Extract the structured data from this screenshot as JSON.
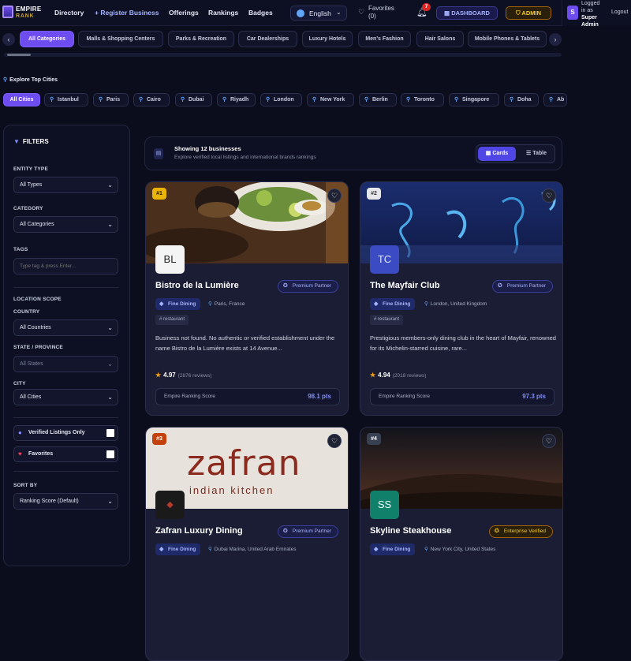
{
  "nav": {
    "logo_line1": "EMPIRE",
    "logo_line2": "RANK",
    "directory": "Directory",
    "register": "+ Register Business",
    "offerings": "Offerings",
    "rankings": "Rankings",
    "badges": "Badges",
    "language": "English",
    "favorites_label": "Favorites",
    "favorites_count": "(0)",
    "notifications_count": "7",
    "dashboard": "DASHBOARD",
    "admin": "ADMIN",
    "avatar_initial": "S",
    "logged_in_prefix": "Logged in as",
    "logged_in_user": "Super Admin",
    "logout": "Logout"
  },
  "categories": [
    "All Categories",
    "Malls & Shopping Centers",
    "Parks & Recreation",
    "Car Dealerships",
    "Luxury Hotels",
    "Men's Fashion",
    "Hair Salons",
    "Mobile Phones & Tablets"
  ],
  "cities_heading": "Explore Top Cities",
  "cities": [
    "All Cities",
    "Istanbul",
    "Paris",
    "Cairo",
    "Dubai",
    "Riyadh",
    "London",
    "New York",
    "Berlin",
    "Toronto",
    "Singapore",
    "Doha",
    "Ab"
  ],
  "filters": {
    "title": "FILTERS",
    "entity_type_label": "ENTITY TYPE",
    "entity_type_value": "All Types",
    "category_label": "CATEGORY",
    "category_value": "All Categories",
    "tags_label": "TAGS",
    "tags_placeholder": "Type tag & press Enter...",
    "location_scope_label": "LOCATION SCOPE",
    "country_label": "COUNTRY",
    "country_value": "All Countries",
    "state_label": "STATE / PROVINCE",
    "state_value": "All States",
    "city_label": "CITY",
    "city_value": "All Cities",
    "verified_label": "Verified Listings Only",
    "favorites_label": "Favorites",
    "sort_label": "SORT BY",
    "sort_value": "Ranking Score (Default)"
  },
  "results": {
    "title": "Showing 12 businesses",
    "subtitle": "Explore verified local listings and international brands rankings",
    "view_cards": "Cards",
    "view_table": "Table"
  },
  "listings": [
    {
      "rank": "#1",
      "initials": "BL",
      "name": "Bistro de la Lumière",
      "badge": "Premium Partner",
      "tag": "Fine Dining",
      "location": "Paris, France",
      "subtag": "# restaurant",
      "description": "Business not found. No authentic or verified establishment under the name Bistro de la Lumière exists at 14 Avenue...",
      "rating": "4.97",
      "reviews": "(2876 reviews)",
      "score_label": "Empire Ranking Score",
      "score": "98.1 pts"
    },
    {
      "rank": "#2",
      "initials": "TC",
      "name": "The Mayfair Club",
      "badge": "Premium Partner",
      "tag": "Fine Dining",
      "location": "London, United Kingdom",
      "subtag": "# restaurant",
      "description": "Prestigious members-only dining club in the heart of Mayfair, renowned for its Michelin-starred cuisine, rare...",
      "rating": "4.94",
      "reviews": "(2018 reviews)",
      "score_label": "Empire Ranking Score",
      "score": "97.3 pts"
    },
    {
      "rank": "#3",
      "image_text_1": "zafran",
      "image_text_2": "indian kitchen",
      "name": "Zafran Luxury Dining",
      "badge": "Premium Partner",
      "tag": "Fine Dining",
      "location": "Dubai Marina, United Arab Emirates"
    },
    {
      "rank": "#4",
      "initials": "SS",
      "name": "Skyline Steakhouse",
      "badge": "Enterprise Verified",
      "tag": "Fine Dining",
      "location": "New York City, United States"
    }
  ]
}
